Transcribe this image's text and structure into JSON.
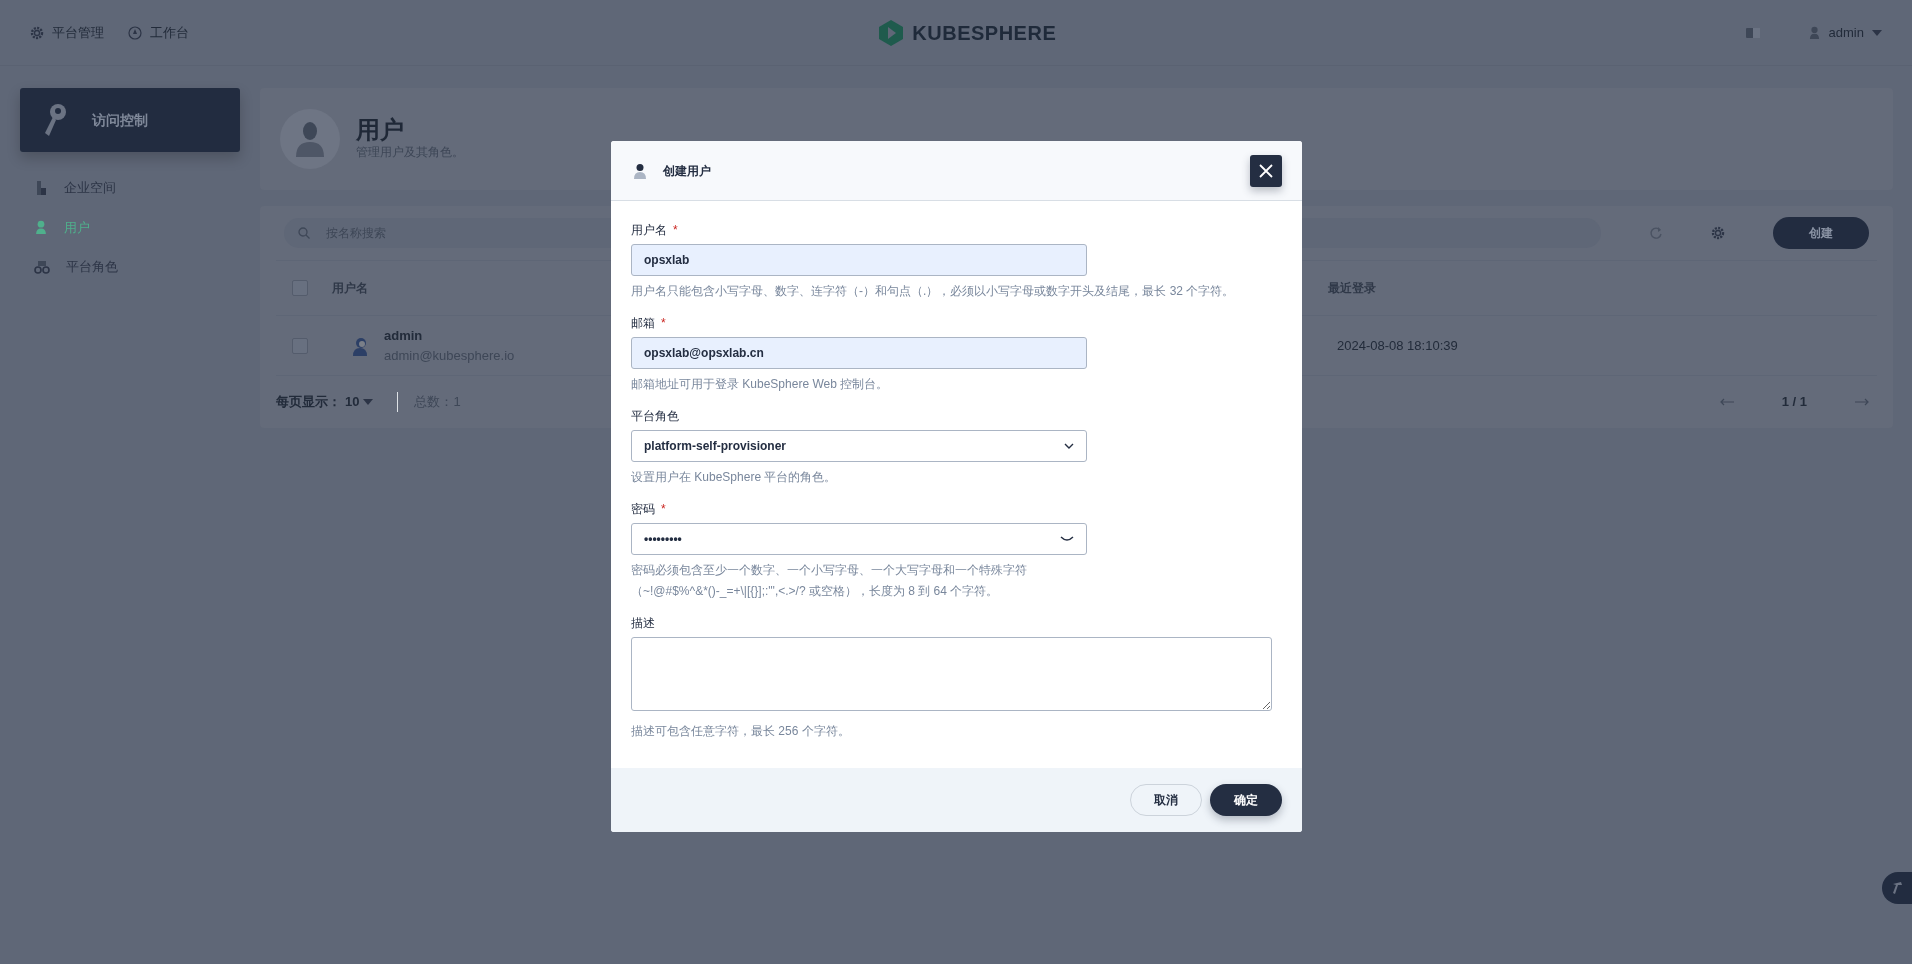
{
  "top_nav": {
    "items": [
      {
        "label": "平台管理",
        "kind": "platform"
      },
      {
        "label": "工作台",
        "kind": "workbench"
      }
    ],
    "logo": "KUBESPHERE",
    "user": "admin"
  },
  "sidebar": {
    "title": "访问控制",
    "items": [
      {
        "label": "企业空间",
        "kind": "workspace",
        "selected": false
      },
      {
        "label": "用户",
        "kind": "user",
        "selected": true
      },
      {
        "label": "平台角色",
        "kind": "role",
        "selected": false
      }
    ]
  },
  "page_header": {
    "title": "用户",
    "description": "管理用户及其角色。"
  },
  "toolbar": {
    "search_placeholder": "按名称搜索",
    "create_button": "创建"
  },
  "table": {
    "columns": [
      "用户名",
      "最近登录"
    ],
    "select_all_checked": false,
    "rows": [
      {
        "name": "admin",
        "email": "admin@kubesphere.io",
        "last_login": "2024-08-08 18:10:39",
        "checked": false
      }
    ]
  },
  "pagination": {
    "page_size_label": "每页显示：",
    "page_size": "10",
    "total": "总数：1",
    "page": "1 / 1"
  },
  "dialog": {
    "title": "创建用户",
    "fields": [
      {
        "kind": "text",
        "label": "用户名",
        "required_mark": "*",
        "value": "opsxlab",
        "hint": "用户名只能包含小写字母、数字、连字符（-）和句点（.），必须以小写字母或数字开头及结尾，最长 32 个字符。"
      },
      {
        "kind": "text",
        "label": "邮箱",
        "required_mark": "*",
        "value": "opsxlab@opsxlab.cn",
        "hint": "邮箱地址可用于登录 KubeSphere Web 控制台。"
      },
      {
        "kind": "select",
        "label": "平台角色",
        "value": "platform-self-provisioner",
        "hint": "设置用户在 KubeSphere 平台的角色。"
      },
      {
        "kind": "password",
        "label": "密码",
        "required_mark": "*",
        "value": "•••••••••",
        "hint": "密码必须包含至少一个数字、一个小写字母、一个大写字母和一个特殊字符",
        "hint_2": "（~!@#$%^&*()-_=+\\|[{}];:'\",<.>/? 或空格），长度为 8 到 64 个字符。"
      },
      {
        "kind": "textarea",
        "label": "描述",
        "hint": "描述可包含任意字符，最长 256 个字符。"
      }
    ],
    "cancel_button": "取消",
    "ok_button": "确定"
  }
}
